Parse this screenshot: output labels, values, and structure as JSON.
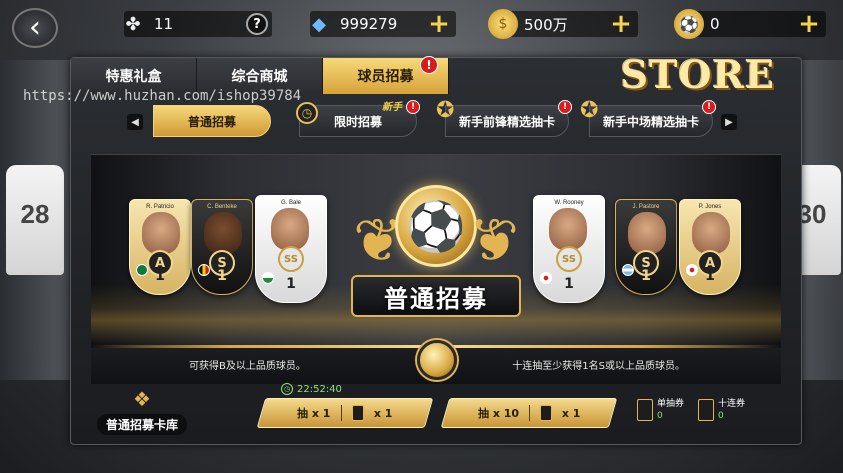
{
  "topbar": {
    "back_icon": "chevron-left-icon",
    "resources": [
      {
        "icon": "clover-icon",
        "value": "11",
        "action": "?"
      },
      {
        "icon": "gem-icon",
        "value": "999279",
        "action": "+"
      },
      {
        "icon": "coin-icon",
        "value": "500万",
        "action": "+"
      },
      {
        "icon": "ball-token-icon",
        "value": "0",
        "action": "+"
      }
    ]
  },
  "logo": "STORE",
  "watermark": "https://www.huzhan.com/ishop39784",
  "tabs": [
    {
      "label": "特惠礼盒",
      "active": false
    },
    {
      "label": "综合商城",
      "active": false
    },
    {
      "label": "球员招募",
      "active": true,
      "warn": "!"
    }
  ],
  "subtabs": [
    {
      "label": "普通招募",
      "active": true
    },
    {
      "label": "限时招募",
      "badge": "新手",
      "warn": "!"
    },
    {
      "label": "新手前锋精选抽卡",
      "warn": "!"
    },
    {
      "label": "新手中场精选抽卡",
      "warn": "!"
    }
  ],
  "banner": {
    "title": "普通招募",
    "desc_left": "可获得B及以上品质球员。",
    "desc_right": "十连抽至少获得1名S或以上品质球员。",
    "cards": [
      {
        "name": "R. Patricio",
        "rank": "A",
        "num": "1",
        "type": "gold"
      },
      {
        "name": "C. Benteke",
        "rank": "S",
        "num": "1",
        "type": "s"
      },
      {
        "name": "G. Bale",
        "rank": "SS",
        "num": "1",
        "type": "ss"
      },
      {
        "name": "W. Rooney",
        "rank": "SS",
        "num": "1",
        "type": "ss"
      },
      {
        "name": "J. Pastore",
        "rank": "S",
        "num": "1",
        "type": "s"
      },
      {
        "name": "P. Jones",
        "rank": "A",
        "num": "1",
        "type": "gold"
      }
    ]
  },
  "deck_label": "普通招募卡库",
  "timer": "22:52:40",
  "buttons": {
    "single": {
      "label": "抽 x 1",
      "cost": "x 1"
    },
    "ten": {
      "label": "抽 x 10",
      "cost": "x 1"
    }
  },
  "vouchers": [
    {
      "label": "单抽券",
      "count": "0"
    },
    {
      "label": "十连券",
      "count": "0"
    }
  ],
  "colors": {
    "accent": "#e2b552",
    "active_tab": "#d6a33a",
    "timer": "#8ee07a",
    "warn": "#d91b1b"
  }
}
